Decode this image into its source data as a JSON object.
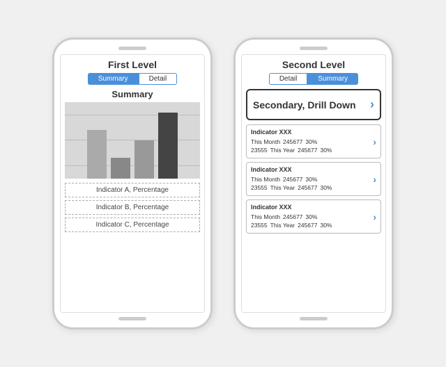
{
  "phone1": {
    "title": "First Level",
    "tabs": [
      {
        "label": "Summary",
        "active": true
      },
      {
        "label": "Detail",
        "active": false
      }
    ],
    "screen_title": "Summary",
    "chart": {
      "bars": [
        {
          "height": 70,
          "color": "#aaa"
        },
        {
          "height": 30,
          "color": "#888"
        },
        {
          "height": 55,
          "color": "#999"
        },
        {
          "height": 95,
          "color": "#444"
        }
      ]
    },
    "indicators": [
      {
        "label": "Indicator A, Percentage"
      },
      {
        "label": "Indicator B, Percentage"
      },
      {
        "label": "Indicator C, Percentage"
      }
    ]
  },
  "phone2": {
    "title": "Second Level",
    "tabs": [
      {
        "label": "Detail",
        "active": false
      },
      {
        "label": "Summary",
        "active": true
      }
    ],
    "drill_down": {
      "label": "Secondary, Drill Down",
      "chevron": "›"
    },
    "indicators": [
      {
        "title": "Indicator XXX",
        "this_month_label": "This Month",
        "this_month_value": "245677",
        "this_month_pct": "30%",
        "year_label": "23555",
        "this_year_label": "This Year",
        "this_year_value": "245677",
        "this_year_pct": "30%"
      },
      {
        "title": "Indicator XXX",
        "this_month_label": "This Month",
        "this_month_value": "245677",
        "this_month_pct": "30%",
        "year_label": "23555",
        "this_year_label": "This Year",
        "this_year_value": "245677",
        "this_year_pct": "30%"
      },
      {
        "title": "Indicator XXX",
        "this_month_label": "This Month",
        "this_month_value": "245677",
        "this_month_pct": "30%",
        "year_label": "23555",
        "this_year_label": "This Year",
        "this_year_value": "245677",
        "this_year_pct": "30%"
      }
    ]
  }
}
